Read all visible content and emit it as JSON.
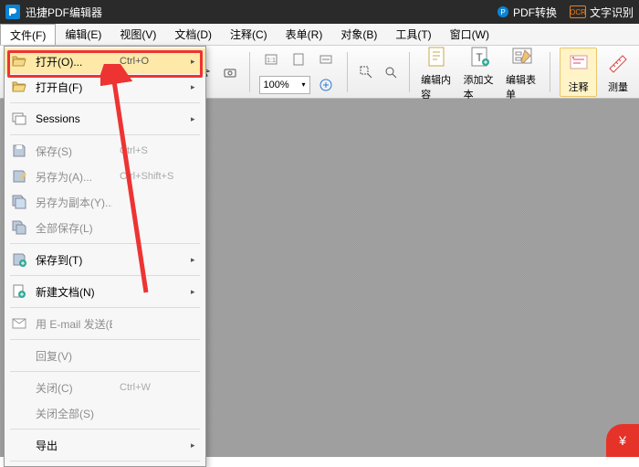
{
  "title": "迅捷PDF编辑器",
  "titlebar_right": {
    "pdf_convert": "PDF转换",
    "ocr": "文字识别",
    "ocr_badge": "OCR"
  },
  "menus": [
    "文件(F)",
    "编辑(E)",
    "视图(V)",
    "文档(D)",
    "注释(C)",
    "表单(R)",
    "对象(B)",
    "工具(T)",
    "窗口(W)"
  ],
  "zoom_value": "100%",
  "tool_labels": {
    "edit_content": "编辑内容",
    "add_text": "添加文本",
    "edit_form": "编辑表单",
    "annot": "注释",
    "measure": "测量"
  },
  "file_menu": [
    {
      "id": "open",
      "label": "打开(O)...",
      "shortcut": "Ctrl+O",
      "icon": "folder-open",
      "enabled": true,
      "submenu": true,
      "hi": true
    },
    {
      "id": "open_from",
      "label": "打开自(F)",
      "icon": "folder-open",
      "enabled": true,
      "submenu": true
    },
    {
      "sep": true
    },
    {
      "id": "sessions",
      "label": "Sessions",
      "icon": "sessions",
      "enabled": true,
      "submenu": true
    },
    {
      "sep": true
    },
    {
      "id": "save",
      "label": "保存(S)",
      "shortcut": "Ctrl+S",
      "icon": "save",
      "enabled": false
    },
    {
      "id": "save_as",
      "label": "另存为(A)...",
      "shortcut": "Ctrl+Shift+S",
      "icon": "save-as",
      "enabled": false
    },
    {
      "id": "save_copy",
      "label": "另存为副本(Y)...",
      "icon": "save-copy",
      "enabled": false
    },
    {
      "id": "save_all",
      "label": "全部保存(L)",
      "icon": "save-all",
      "enabled": false
    },
    {
      "sep": true
    },
    {
      "id": "save_to",
      "label": "保存到(T)",
      "icon": "save-to",
      "enabled": true,
      "submenu": true
    },
    {
      "sep": true
    },
    {
      "id": "new_doc",
      "label": "新建文档(N)",
      "icon": "new-doc",
      "enabled": true,
      "submenu": true
    },
    {
      "sep": true
    },
    {
      "id": "email",
      "label": "用 E-mail 发送(E)...",
      "icon": "email",
      "enabled": false
    },
    {
      "sep": true
    },
    {
      "id": "revert",
      "label": "回复(V)",
      "enabled": false
    },
    {
      "sep": true
    },
    {
      "id": "close",
      "label": "关闭(C)",
      "shortcut": "Ctrl+W",
      "enabled": false
    },
    {
      "id": "close_all",
      "label": "关闭全部(S)",
      "enabled": false
    },
    {
      "sep": true
    },
    {
      "id": "export",
      "label": "导出",
      "enabled": true,
      "submenu": true
    },
    {
      "sep": true
    }
  ],
  "annotation": {
    "highlight_target": "open"
  }
}
